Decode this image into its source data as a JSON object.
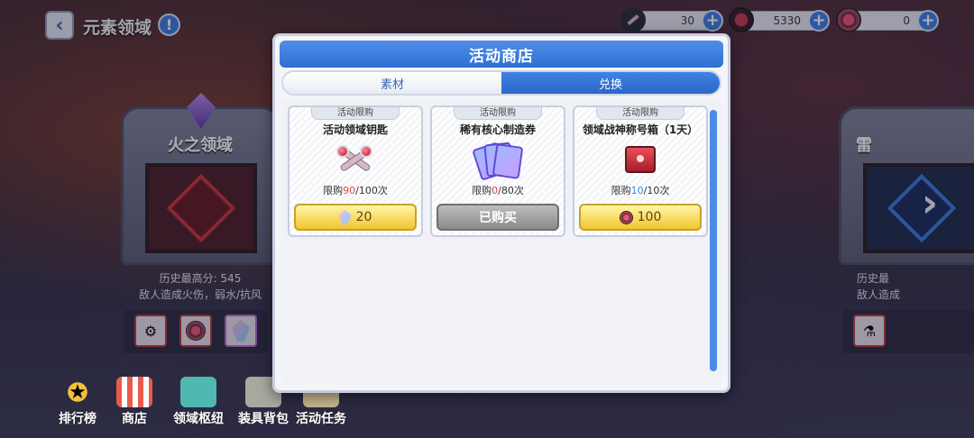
{
  "top_bar": {
    "back_icon": "chevron-left-icon",
    "title": "元素领域",
    "info_icon": "!",
    "resources": [
      {
        "name": "key",
        "icon": "key-icon",
        "value": "30"
      },
      {
        "name": "core",
        "icon": "core-icon",
        "value": "5330"
      },
      {
        "name": "coin",
        "icon": "coin-icon",
        "value": "0"
      }
    ]
  },
  "background": {
    "left_gate": {
      "name": "火之领域",
      "best_score": "历史最高分: 545",
      "desc": "敌人造成火伤，弱水/抗风"
    },
    "right_gate": {
      "name": "雷",
      "best_score": "历史最",
      "desc": "敌人造成"
    }
  },
  "bottom_nav": [
    {
      "label": "排行榜",
      "icon": "trophy-icon"
    },
    {
      "label": "商店",
      "icon": "shop-icon"
    },
    {
      "label": "领域枢纽",
      "icon": "hub-icon"
    },
    {
      "label": "装具背包",
      "icon": "backpack-icon"
    },
    {
      "label": "活动任务",
      "icon": "quest-icon"
    }
  ],
  "modal": {
    "title": "活动商店",
    "tabs": [
      {
        "label": "素材",
        "active": false
      },
      {
        "label": "兑换",
        "active": true
      }
    ],
    "items": [
      {
        "tag": "活动限购",
        "name": "活动领域钥匙",
        "limit_prefix": "限购",
        "limit_used": "90",
        "limit_rest": "/100次",
        "price": "20",
        "price_icon": "crystal-icon",
        "state": "available"
      },
      {
        "tag": "活动限购",
        "name": "稀有核心制造券",
        "limit_prefix": "限购",
        "limit_used": "0",
        "limit_rest": "/80次",
        "button_text": "已购买",
        "state": "purchased"
      },
      {
        "tag": "活动限购",
        "name": "领域战神称号箱（1天）",
        "limit_prefix": "限购",
        "limit_used": "10",
        "limit_rest": "/10次",
        "price": "100",
        "price_icon": "coin-icon",
        "state": "available"
      }
    ]
  }
}
